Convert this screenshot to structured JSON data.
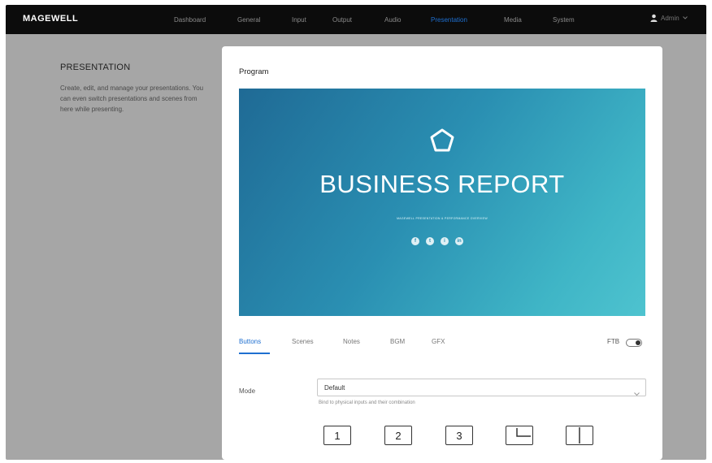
{
  "header": {
    "logo": "MAGEWELL",
    "nav": [
      {
        "label": "Dashboard"
      },
      {
        "label": "General"
      },
      {
        "label": "Input"
      },
      {
        "label": "Output"
      },
      {
        "label": "Audio"
      },
      {
        "label": "Presentation",
        "active": true
      },
      {
        "label": "Media"
      },
      {
        "label": "System"
      }
    ],
    "user": {
      "name": "Admin",
      "icon": "user-icon"
    }
  },
  "intro": {
    "title": "PRESENTATION",
    "description": "Create, edit, and manage your presentations. You can even switch presentations and scenes from here while presenting."
  },
  "panel": {
    "title": "Program",
    "preview": {
      "logo_icon": "pentagon-logo-icon",
      "title": "BUSINESS REPORT",
      "subtitle": "MAGEWELL PRESENTATION & PERFORMANCE OVERVIEW",
      "socials": [
        "f",
        "t",
        "i",
        "in"
      ]
    },
    "tabs": [
      {
        "label": "Buttons",
        "active": true
      },
      {
        "label": "Scenes"
      },
      {
        "label": "Notes"
      },
      {
        "label": "BGM"
      },
      {
        "label": "GFX"
      }
    ],
    "ftb": {
      "label": "FTB",
      "on": false
    },
    "mode": {
      "label": "Mode",
      "value": "Default",
      "hint": "Bind to physical inputs and their combination"
    },
    "buttons": [
      {
        "label": "1",
        "icon": ""
      },
      {
        "label": "2",
        "icon": ""
      },
      {
        "label": "3",
        "icon": ""
      },
      {
        "label": "",
        "icon": "pip-layout-icon"
      },
      {
        "label": "",
        "icon": "split-layout-icon"
      }
    ]
  },
  "colors": {
    "accent": "#1e6fd0",
    "topbar": "#0c0c0c",
    "page_bg": "#a6a6a6",
    "preview_gradient_start": "#1f6a95",
    "preview_gradient_end": "#4ec3cf"
  }
}
